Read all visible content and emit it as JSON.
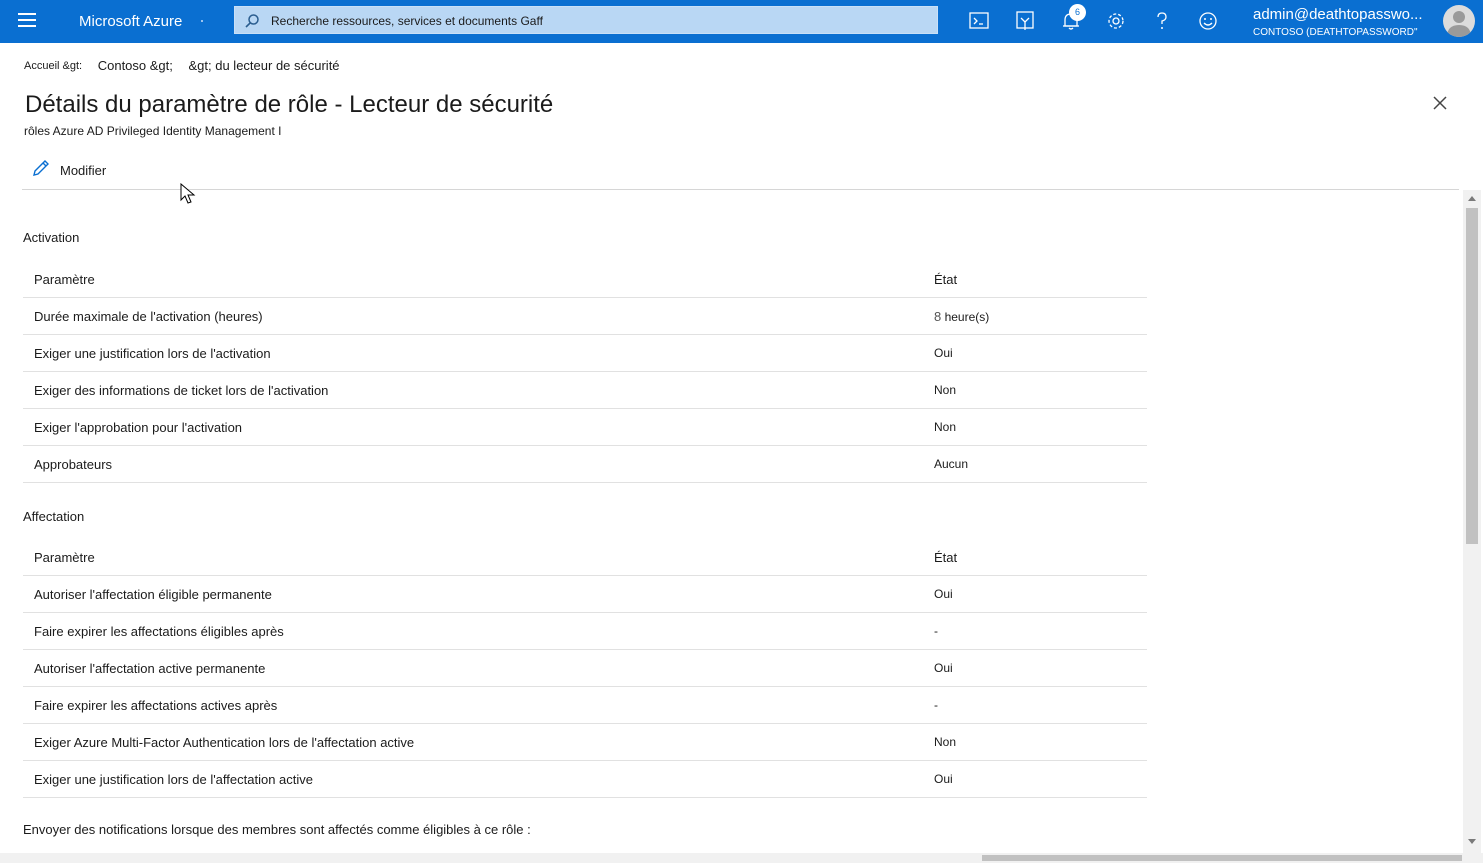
{
  "topbar": {
    "brand": "Microsoft Azure",
    "search_placeholder": "Recherche ressources, services et documents Gaff",
    "notification_count": "6",
    "user": "admin@deathtopasswo...",
    "tenant": "CONTOSO (DEATHTOPASSWORD\"",
    "icons": [
      "menu-icon",
      "search-icon",
      "cloud-shell-icon",
      "directory-filter-icon",
      "notifications-icon",
      "settings-icon",
      "help-icon",
      "feedback-icon"
    ]
  },
  "breadcrumb": {
    "home": "Accueil &gt:",
    "contoso": "Contoso &gt;",
    "current": "&gt; du lecteur de sécurité"
  },
  "page": {
    "title": "Détails du paramètre de rôle - Lecteur de sécurité",
    "subtitle": "rôles Azure AD Privileged Identity Management I"
  },
  "toolbar": {
    "edit_label": "Modifier"
  },
  "activation": {
    "title": "Activation",
    "header": {
      "param": "Paramètre",
      "state": "État"
    },
    "rows": [
      {
        "param": "Durée maximale de l'activation (heures)",
        "num": "8",
        "state": "heure(s)"
      },
      {
        "param": "Exiger une justification lors de l'activation",
        "state": "Oui"
      },
      {
        "param": "Exiger des informations de ticket lors de l'activation",
        "state": "Non"
      },
      {
        "param": "Exiger l'approbation pour l'activation",
        "state": "Non"
      },
      {
        "param": "Approbateurs",
        "state": "Aucun"
      }
    ]
  },
  "assignment": {
    "title": "Affectation",
    "header": {
      "param": "Paramètre",
      "state": "État"
    },
    "rows": [
      {
        "param": "Autoriser l'affectation éligible permanente",
        "state": "Oui"
      },
      {
        "param": "Faire expirer les affectations éligibles après",
        "state": "-"
      },
      {
        "param": "Autoriser l'affectation active permanente",
        "state": "Oui"
      },
      {
        "param": "Faire expirer les affectations actives après",
        "state": "-"
      },
      {
        "param": "Exiger Azure Multi-Factor Authentication lors de l'affectation active",
        "state": "Non"
      },
      {
        "param": "Exiger une justification lors de l'affectation active",
        "state": "Oui"
      }
    ]
  },
  "notifications": {
    "text": "Envoyer des notifications lorsque des membres sont affectés comme éligibles à ce rôle :"
  }
}
